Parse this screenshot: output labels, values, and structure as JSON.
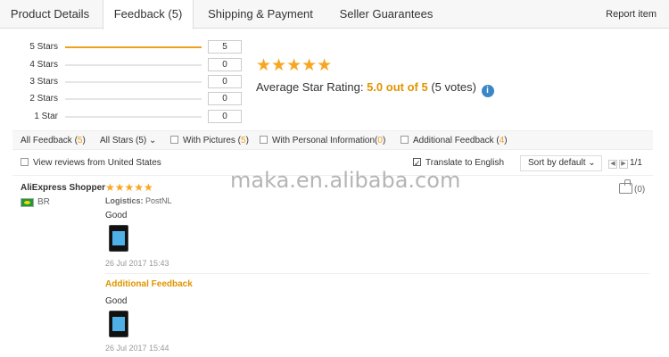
{
  "tabs": [
    {
      "label": "Product Details"
    },
    {
      "label": "Feedback (5)"
    },
    {
      "label": "Shipping & Payment"
    },
    {
      "label": "Seller Guarantees"
    }
  ],
  "report_label": "Report item",
  "ratings": [
    {
      "label": "5 Stars",
      "count": "5",
      "fraction": 1.0
    },
    {
      "label": "4 Stars",
      "count": "0",
      "fraction": 0
    },
    {
      "label": "3 Stars",
      "count": "0",
      "fraction": 0
    },
    {
      "label": "2 Stars",
      "count": "0",
      "fraction": 0
    },
    {
      "label": "1 Star",
      "count": "0",
      "fraction": 0
    }
  ],
  "average": {
    "stars": "★★★★★",
    "label": "Average Star Rating:",
    "score": "5.0 out of 5",
    "votes": "(5 votes)",
    "info_icon": "i"
  },
  "filters": {
    "all_feedback": "All Feedback (",
    "all_feedback_count": "5",
    "all_stars": "All Stars (5)",
    "with_pictures": "With Pictures (",
    "with_pictures_count": "5",
    "with_personal": "With Personal Information(",
    "with_personal_count": "0",
    "additional": "Additional Feedback (",
    "additional_count": "4",
    "close_paren": ")"
  },
  "options": {
    "view_us": "View reviews from United States",
    "translate": "Translate to English",
    "sort": "Sort by default",
    "page": "1/1"
  },
  "review": {
    "reviewer": "AliExpress Shopper",
    "country": "BR",
    "stars": "★★★★★",
    "logistics_label": "Logistics:",
    "logistics_value": "PostNL",
    "text": "Good",
    "date": "26 Jul 2017 15:43",
    "additional_label": "Additional Feedback",
    "additional_text": "Good",
    "additional_date": "26 Jul 2017 15:44",
    "helpful": "(0)"
  },
  "watermark": "maka.en.alibaba.com",
  "colors": {
    "accent": "#f0a020",
    "star": "#f7a623",
    "info": "#3a87c8"
  }
}
